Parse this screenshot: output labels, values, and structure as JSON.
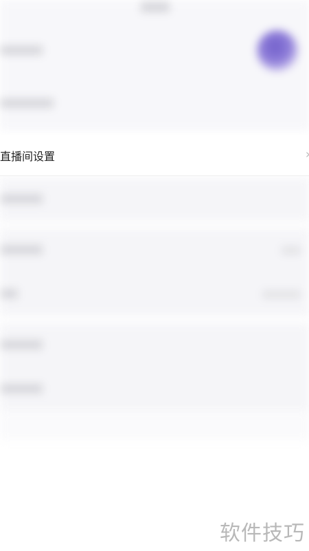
{
  "live_room_settings": {
    "label": "直播间设置",
    "chevron": "›"
  },
  "watermark": {
    "text": "软件技巧"
  },
  "colors": {
    "background": "#ffffff",
    "blurred_panel": "#f5f5f8",
    "avatar": "#6b58c8",
    "watermark": "#b8b8b8"
  }
}
